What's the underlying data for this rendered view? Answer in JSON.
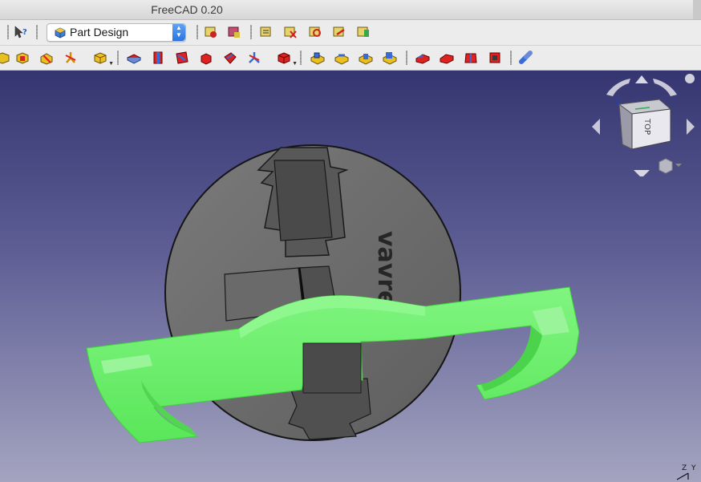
{
  "window": {
    "title": "FreeCAD 0.20"
  },
  "toolbar_top": {
    "workbench_selector": {
      "label": "Part Design",
      "icon": "partdesign-workbench-icon"
    }
  },
  "viewport": {
    "model_text": "vavren",
    "navcube": {
      "face_label": "TOP"
    },
    "axis_labels": {
      "z": "Z",
      "y": "Y"
    }
  },
  "colors": {
    "viewport_top": "#353571",
    "viewport_bottom": "#a4a4c0",
    "disk": "#6e6e6e",
    "selection_green": "#66ee66",
    "accent_blue": "#2b74e0"
  }
}
